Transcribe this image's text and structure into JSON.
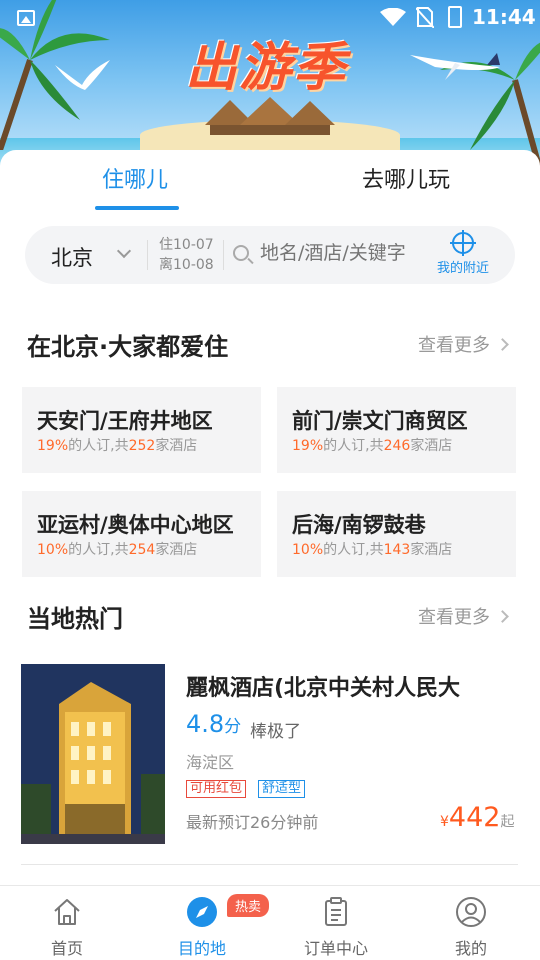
{
  "status_bar": {
    "time": "11:44"
  },
  "banner": {
    "title": "出游季"
  },
  "tabs": [
    {
      "label": "住哪儿",
      "active": true
    },
    {
      "label": "去哪儿玩",
      "active": false
    }
  ],
  "search": {
    "city": "北京",
    "checkin": "住10-07",
    "checkout": "离10-08",
    "placeholder": "地名/酒店/关键字",
    "nearby_label": "我的附近"
  },
  "popular_areas": {
    "title": "在北京·大家都爱住",
    "more_label": "查看更多",
    "items": [
      {
        "name": "天安门/王府井地区",
        "percent": "19%",
        "text1": "的人订,共",
        "count": "252",
        "text2": "家酒店"
      },
      {
        "name": "前门/崇文门商贸区",
        "percent": "19%",
        "text1": "的人订,共",
        "count": "246",
        "text2": "家酒店"
      },
      {
        "name": "亚运村/奥体中心地区",
        "percent": "10%",
        "text1": "的人订,共",
        "count": "254",
        "text2": "家酒店"
      },
      {
        "name": "后海/南锣鼓巷",
        "percent": "10%",
        "text1": "的人订,共",
        "count": "143",
        "text2": "家酒店"
      }
    ]
  },
  "local_hot": {
    "title": "当地热门",
    "more_label": "查看更多",
    "hotel": {
      "name": "麗枫酒店(北京中关村人民大",
      "score": "4.8",
      "score_unit": "分",
      "score_desc": "棒极了",
      "district": "海淀区",
      "tags": [
        "可用红包",
        "舒适型"
      ],
      "recent_booking": "最新预订26分钟前",
      "currency": "¥",
      "price": "442",
      "price_suffix": "起"
    }
  },
  "bottom_nav": {
    "items": [
      {
        "label": "首页",
        "icon": "home-icon"
      },
      {
        "label": "目的地",
        "icon": "compass-icon",
        "active": true
      },
      {
        "label": "订单中心",
        "icon": "clipboard-icon"
      },
      {
        "label": "我的",
        "icon": "user-icon"
      }
    ],
    "badge": "热卖"
  },
  "colors": {
    "accent": "#1e90e8",
    "highlight": "#ff6a2b",
    "badge": "#f4614c"
  }
}
